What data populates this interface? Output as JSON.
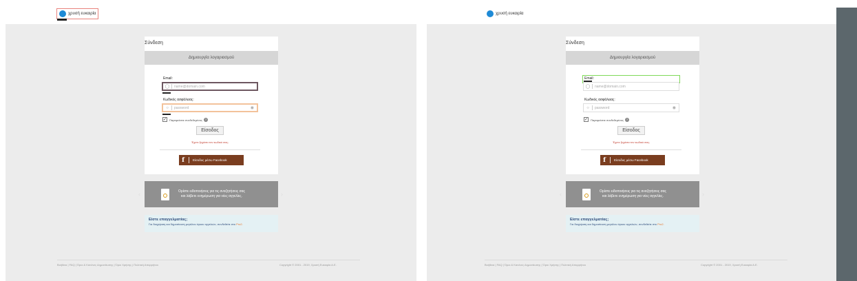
{
  "logo": {
    "text": "χρυσή ευκαιρία"
  },
  "card": {
    "title": "Σύνδεση",
    "tab": "Δημιουργία λογαριασμού",
    "email_label": "Email:",
    "email_placeholder": "name@domain.com",
    "password_label": "Κωδικός ασφάλειας:",
    "password_placeholder": "password",
    "remember_label": "Παραμείνετε συνδεδεμένος",
    "login_button": "Είσοδος",
    "forgot_link": "Έχετε ξεχάσει τον κωδικό σας;",
    "facebook_button": "Είσοδος μέσω Facebook"
  },
  "banner": {
    "line1": "Ορίστε ειδοποιήσεις για τις αναζητήσεις σας",
    "line2": "και λάβετε ενημέρωση για νέες αγγελίες."
  },
  "pro": {
    "title": "Είστε επαγγελματίας;",
    "text": "Για διαχείριση και δημοσίευση μεγάλου όγκου αγγελιών, συνδεθείτε στο",
    "link": "Pro2."
  },
  "footer": {
    "links": "Βοήθεια | FAQ | Όροι & Κανόνες Δημοσίευσης | Όροι Χρήσης | Πολιτική Απορρήτου",
    "copyright": "Copyright © 2001 - 2019, Χρυσή Ευκαιρία Α.Ε."
  },
  "colors": {
    "facebook": "#7a3d1f",
    "banner": "#909090",
    "pro_bg": "#e4f1f4",
    "brand_blue": "#1e8ad6"
  }
}
